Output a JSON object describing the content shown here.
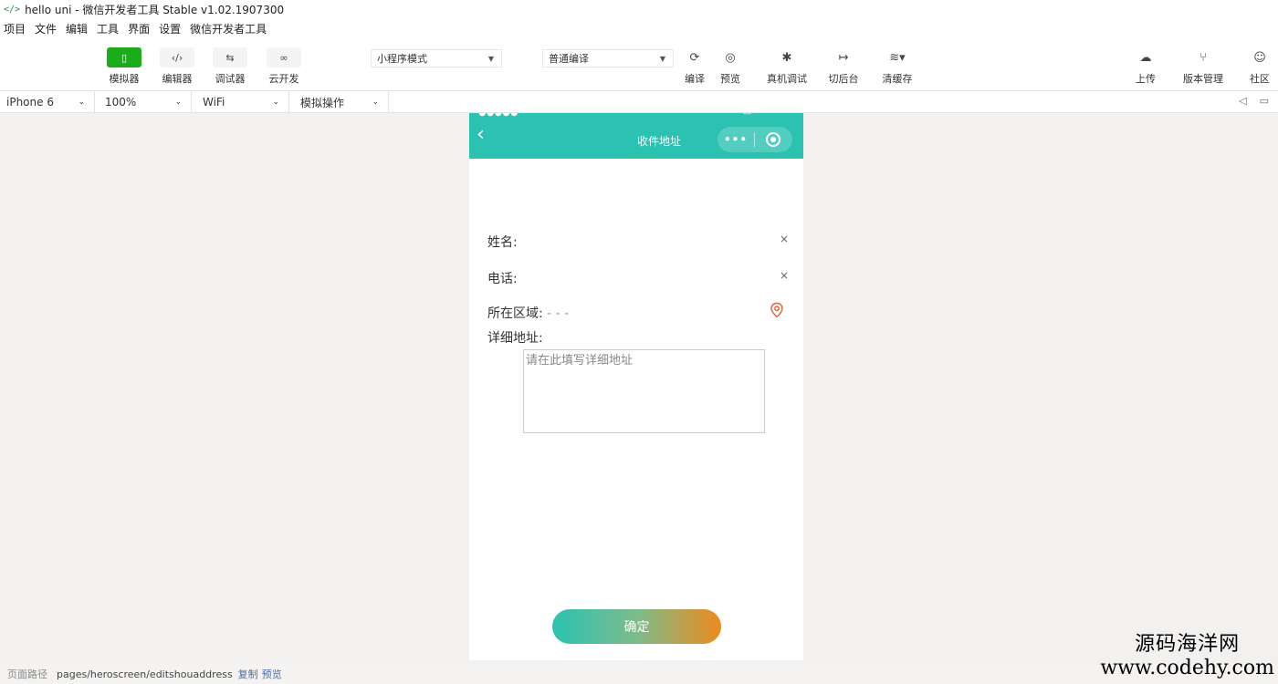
{
  "window": {
    "title": "hello uni - 微信开发者工具 Stable v1.02.1907300"
  },
  "menu": [
    "项目",
    "文件",
    "编辑",
    "工具",
    "界面",
    "设置",
    "微信开发者工具"
  ],
  "toolbar": {
    "simulator": "模拟器",
    "editor": "编辑器",
    "debugger": "调试器",
    "cloud": "云开发",
    "mode": "小程序模式",
    "compile_mode": "普通编译",
    "compile": "编译",
    "preview": "预览",
    "real_debug": "真机调试",
    "background": "切后台",
    "clear_cache": "清缓存",
    "upload": "上传",
    "version": "版本管理",
    "community": "社区"
  },
  "device": {
    "model": "iPhone 6",
    "zoom": "100%",
    "network": "WiFi",
    "sim_ops": "模拟操作"
  },
  "phone": {
    "nav_title": "收件地址",
    "name_label": "姓名:",
    "phone_label": "电话:",
    "region_label": "所在区域:",
    "region_value": "- - -",
    "address_label": "详细地址:",
    "address_placeholder": "请在此填写详细地址",
    "clear_symbol": "×",
    "confirm": "确定"
  },
  "statusbar": {
    "label": "页面路径",
    "path": "pages/heroscreen/editshouaddress",
    "copy": "复制",
    "preview": "预览"
  },
  "watermark": {
    "line1": "源码海洋网",
    "line2": "www.codehy.com"
  },
  "colors": {
    "nav": "#2cc2b2",
    "simulator_active": "#1aad19",
    "button_start": "#2cc2b2",
    "button_end": "#ee8a1e",
    "pin": "#e0603a"
  }
}
